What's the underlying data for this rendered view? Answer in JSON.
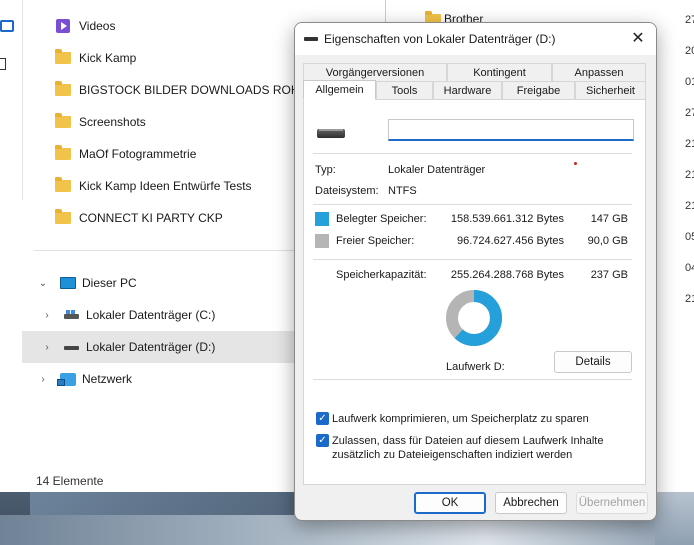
{
  "explorer": {
    "folders": [
      {
        "name": "Videos",
        "icon": "video-folder-icon"
      },
      {
        "name": "Kick Kamp",
        "icon": "folder-icon"
      },
      {
        "name": "BIGSTOCK BILDER DOWNLOADS ROH",
        "icon": "folder-icon"
      },
      {
        "name": "Screenshots",
        "icon": "folder-icon"
      },
      {
        "name": "MaOf Fotogrammetrie",
        "icon": "folder-icon"
      },
      {
        "name": "Kick Kamp Ideen Entwürfe Tests",
        "icon": "folder-icon"
      },
      {
        "name": "CONNECT KI PARTY CKP",
        "icon": "folder-icon"
      }
    ],
    "tree": {
      "this_pc": "Dieser PC",
      "drive_c": "Lokaler Datenträger (C:)",
      "drive_d": "Lokaler Datenträger (D:)",
      "network": "Netzwerk"
    },
    "status": "14 Elemente",
    "right_folder": "Brother",
    "right_column": [
      "27",
      "20",
      "01",
      "27",
      "21",
      "21",
      "21",
      "05",
      "04",
      "21"
    ]
  },
  "dialog": {
    "title": "Eigenschaften von Lokaler Datenträger (D:)",
    "close": "✕",
    "tabs_row1": [
      "Vorgängerversionen",
      "Kontingent",
      "Anpassen"
    ],
    "tabs_row2": [
      "Allgemein",
      "Tools",
      "Hardware",
      "Freigabe",
      "Sicherheit"
    ],
    "active_tab": "Allgemein",
    "name_value": "",
    "type_label": "Typ:",
    "type_value": "Lokaler Datenträger",
    "fs_label": "Dateisystem:",
    "fs_value": "NTFS",
    "used": {
      "label": "Belegter Speicher:",
      "bytes": "158.539.661.312 Bytes",
      "size": "147 GB",
      "color": "#26a0da"
    },
    "free": {
      "label": "Freier Speicher:",
      "bytes": "96.724.627.456 Bytes",
      "size": "90,0 GB",
      "color": "#b5b5b5"
    },
    "capacity": {
      "label": "Speicherkapazität:",
      "bytes": "255.264.288.768 Bytes",
      "size": "237 GB"
    },
    "used_fraction": 0.621,
    "drive_label": "Laufwerk D:",
    "details_button": "Details",
    "compress_label": "Laufwerk komprimieren, um Speicherplatz zu sparen",
    "compress_checked": true,
    "index_label_1": "Zulassen, dass für Dateien auf diesem Laufwerk Inhalte",
    "index_label_2": "zusätzlich zu Dateieigenschaften indiziert werden",
    "index_checked": true,
    "ok": "OK",
    "cancel": "Abbrechen",
    "apply": "Übernehmen"
  }
}
